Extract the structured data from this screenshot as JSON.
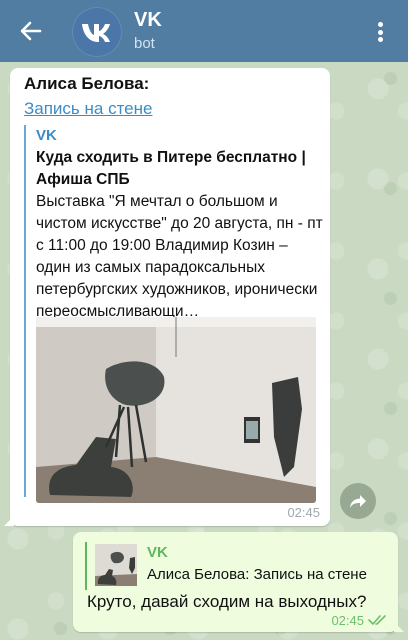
{
  "header": {
    "title": "VK",
    "subtitle": "bot"
  },
  "incoming": {
    "sender": "Алиса Белова:",
    "link_text": "Запись на стене",
    "preview_site": "VK",
    "preview_title": "Куда сходить в Питере бесплатно | Афиша СПБ",
    "preview_desc": "Выставка \"Я мечтал о большом и чистом искусстве\" до 20 августа, пн - пт с 11:00 до 19:00 Владимир Козин – один из самых парадоксальных петербургских художников, иронически переосмысливающи…",
    "time": "02:45"
  },
  "outgoing": {
    "reply_name": "VK",
    "reply_text": "Алиса Белова: Запись на стене",
    "text": "Круто, давай сходим на выходных?",
    "time": "02:45"
  },
  "colors": {
    "header_bg": "#527da3",
    "link": "#3a8cc8",
    "outgoing_bg": "#effdde",
    "accent_green": "#5fb65e"
  }
}
